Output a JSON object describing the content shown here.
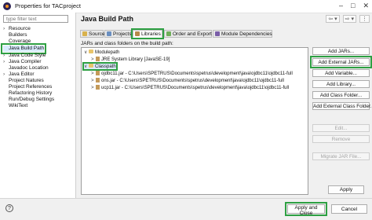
{
  "window": {
    "title": "Properties for TACproject",
    "controls": [
      "–",
      "□",
      "✕"
    ]
  },
  "sidebar": {
    "filter_placeholder": "type filter text",
    "items": [
      {
        "label": "Resource",
        "expandable": true
      },
      {
        "label": "Builders",
        "expandable": false
      },
      {
        "label": "Coverage",
        "expandable": false
      },
      {
        "label": "Java Build Path",
        "expandable": false,
        "selected": true
      },
      {
        "label": "Java Code Style",
        "expandable": true
      },
      {
        "label": "Java Compiler",
        "expandable": true
      },
      {
        "label": "Javadoc Location",
        "expandable": false
      },
      {
        "label": "Java Editor",
        "expandable": true
      },
      {
        "label": "Project Natures",
        "expandable": false
      },
      {
        "label": "Project References",
        "expandable": false
      },
      {
        "label": "Refactoring History",
        "expandable": false
      },
      {
        "label": "Run/Debug Settings",
        "expandable": false
      },
      {
        "label": "WikiText",
        "expandable": false
      }
    ]
  },
  "main": {
    "title": "Java Build Path",
    "nav_arrows": [
      "⇦ ▾",
      "⇨ ▾",
      "⋮"
    ],
    "tabs": [
      {
        "label": "Source",
        "icon": "source-folder-icon"
      },
      {
        "label": "Projects",
        "icon": "projects-icon"
      },
      {
        "label": "Libraries",
        "icon": "libraries-icon",
        "active": true
      },
      {
        "label": "Order and Export",
        "icon": "order-export-icon"
      },
      {
        "label": "Module Dependencies",
        "icon": "module-dependencies-icon"
      }
    ],
    "description": "JARs and class folders on the build path:",
    "tree": [
      {
        "label": "Modulepath",
        "level": 0,
        "arrow": "∨"
      },
      {
        "label": "JRE System Library [JavaSE-19]",
        "level": 1,
        "arrow": ">"
      },
      {
        "label": "Classpath",
        "level": 0,
        "arrow": "∨",
        "highlighted": true
      },
      {
        "label": "ojdbc11.jar - C:\\Users\\SPETRUS\\Documents\\spetrus\\development\\java\\ojdbc11\\ojdbc11-full",
        "level": 1,
        "arrow": ">"
      },
      {
        "label": "ons.jar - C:\\Users\\SPETRUS\\Documents\\spetrus\\development\\java\\ojdbc11\\ojdbc11-full",
        "level": 1,
        "arrow": ">"
      },
      {
        "label": "ucp11.jar - C:\\Users\\SPETRUS\\Documents\\spetrus\\development\\java\\ojdbc11\\ojdbc11-full",
        "level": 1,
        "arrow": ">"
      }
    ],
    "buttons": [
      {
        "label": "Add JARs...",
        "enabled": true
      },
      {
        "label": "Add External JARs...",
        "enabled": true,
        "highlighted": true
      },
      {
        "label": "Add Variable...",
        "enabled": true
      },
      {
        "label": "Add Library...",
        "enabled": true
      },
      {
        "label": "Add Class Folder...",
        "enabled": true
      },
      {
        "label": "Add External Class Folder...",
        "enabled": true
      },
      {
        "label": "Edit...",
        "enabled": false
      },
      {
        "label": "Remove",
        "enabled": false
      },
      {
        "label": "Migrate JAR File...",
        "enabled": false
      }
    ],
    "apply_label": "Apply"
  },
  "footer": {
    "help_label": "?",
    "apply_close_label": "Apply and Close",
    "cancel_label": "Cancel"
  },
  "colors": {
    "highlight": "#2ea043",
    "selection": "#dcebfc"
  }
}
